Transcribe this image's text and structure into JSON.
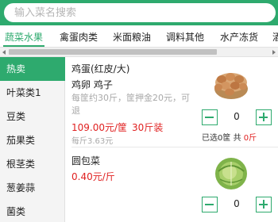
{
  "search": {
    "placeholder": "输入菜名搜索"
  },
  "tabs": [
    "蔬菜水果",
    "禽蛋肉类",
    "米面粮油",
    "调料其他",
    "水产冻货",
    "酒"
  ],
  "sidebar": {
    "items": [
      "热卖",
      "叶菜类1",
      "豆类",
      "茄果类",
      "根茎类",
      "葱姜蒜",
      "菌类"
    ]
  },
  "products": [
    {
      "name": "鸡蛋(红皮/大)",
      "desc": "鸡卵 鸡子",
      "note": "每筐约30斤，筐押金20元，可退",
      "price": "109.00元/筐",
      "min_order": "30斤装",
      "unit_price": "每斤3.63元",
      "image_icon": "eggs-basket-image",
      "qty": "0",
      "selected_label": "已选0筐",
      "total_prefix": "共",
      "total_value": "0斤"
    },
    {
      "name": "圆包菜",
      "price": "0.40元/斤",
      "image_icon": "cabbage-image",
      "qty": "0"
    }
  ],
  "colors": {
    "accent": "#2eaa6e",
    "price": "#e02020",
    "muted": "#a9a9a9"
  }
}
